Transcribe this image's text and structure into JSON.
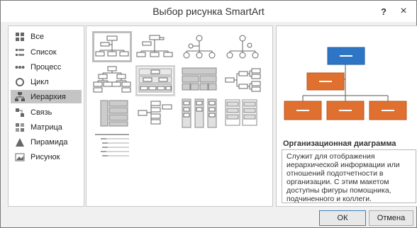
{
  "window": {
    "title": "Выбор рисунка SmartArt",
    "help_label": "?",
    "close_label": "×"
  },
  "categories": [
    {
      "label": "Все",
      "icon": "all-icon"
    },
    {
      "label": "Список",
      "icon": "list-icon"
    },
    {
      "label": "Процесс",
      "icon": "process-icon"
    },
    {
      "label": "Цикл",
      "icon": "cycle-icon"
    },
    {
      "label": "Иерархия",
      "icon": "hierarchy-icon",
      "selected": true
    },
    {
      "label": "Связь",
      "icon": "relationship-icon"
    },
    {
      "label": "Матрица",
      "icon": "matrix-icon"
    },
    {
      "label": "Пирамида",
      "icon": "pyramid-icon"
    },
    {
      "label": "Рисунок",
      "icon": "picture-icon"
    }
  ],
  "preview": {
    "title": "Организационная диаграмма",
    "description": "Служит для отображения иерархической информации или отношений подотчетности в организации. С этим макетом доступны фигуры помощника, подчиненного и коллеги.",
    "colors": {
      "top": "#2e75c6",
      "assistant": "#e07030",
      "child": "#e07030"
    }
  },
  "buttons": {
    "ok": "ОК",
    "cancel": "Отмена"
  }
}
